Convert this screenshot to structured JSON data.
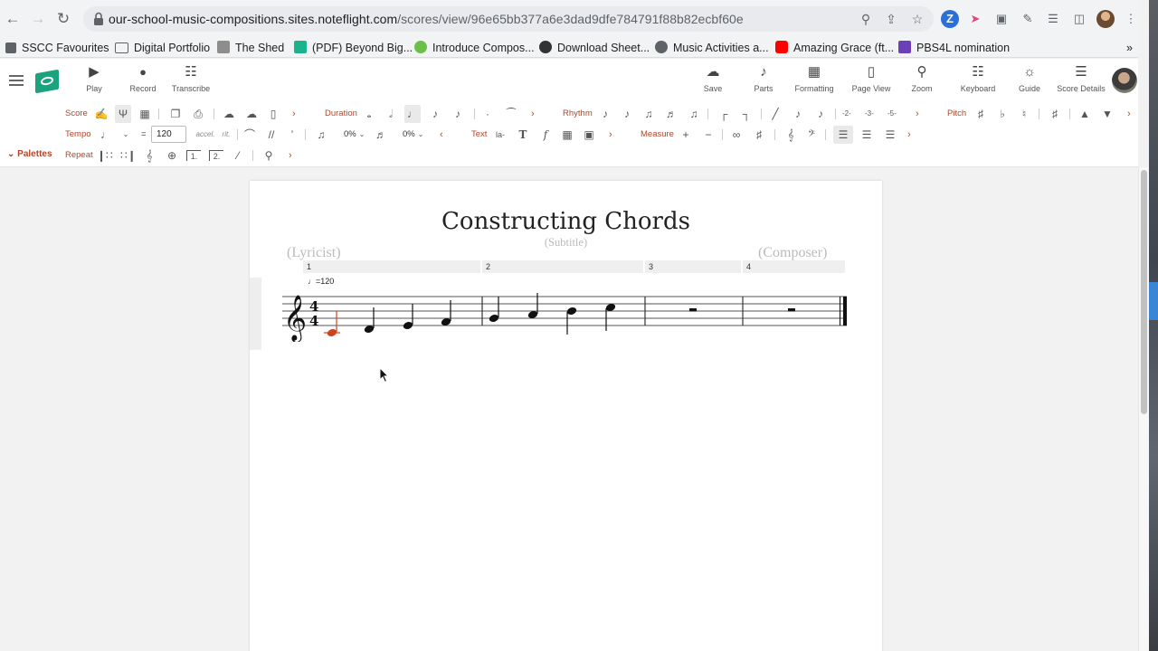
{
  "browser": {
    "url_host": "our-school-music-compositions.sites.noteflight.com",
    "url_path": "/scores/view/96e65bb377a6e3dad9dfe784791f88b82ecbf60e",
    "bookmarks": [
      "SSCC Favourites",
      "Digital Portfolio",
      "The Shed",
      "(PDF) Beyond Big...",
      "Introduce Compos...",
      "Download Sheet...",
      "Music Activities a...",
      "Amazing Grace (ft...",
      "PBS4L nomination"
    ],
    "more_bookmarks": "»"
  },
  "header": {
    "left_buttons": [
      {
        "label": "Play",
        "icon": "play-icon"
      },
      {
        "label": "Record",
        "icon": "record-icon"
      },
      {
        "label": "Transcribe",
        "icon": "piano-icon"
      }
    ],
    "right_buttons": [
      {
        "label": "Save",
        "icon": "cloud-upload-icon"
      },
      {
        "label": "Parts",
        "icon": "guitar-icon"
      },
      {
        "label": "Formatting",
        "icon": "formatting-icon"
      },
      {
        "label": "Page View",
        "icon": "page-icon"
      },
      {
        "label": "Zoom",
        "icon": "zoom-icon"
      },
      {
        "label": "Keyboard",
        "icon": "keyboard-icon"
      },
      {
        "label": "Guide",
        "icon": "compass-icon"
      },
      {
        "label": "Score Details",
        "icon": "list-icon"
      }
    ]
  },
  "toolbar": {
    "row1": {
      "score": "Score",
      "duration": "Duration",
      "rhythm": "Rhythm",
      "pitch": "Pitch",
      "tuplets": [
        "-2-",
        "-3-",
        "-5-"
      ]
    },
    "row2": {
      "tempo": "Tempo",
      "tempo_value": "120",
      "accel": "accel.",
      "rit": "rit.",
      "swing1": "0%",
      "swing2": "0%",
      "text": "Text",
      "lyric": "la-",
      "measure": "Measure"
    },
    "row3": {
      "palettes": "Palettes",
      "repeat": "Repeat",
      "ending1": "1.",
      "ending2": "2."
    }
  },
  "score": {
    "title": "Constructing Chords",
    "subtitle": "(Subtitle)",
    "lyricist": "(Lyricist)",
    "composer": "(Composer)",
    "measure_numbers": [
      "1",
      "2",
      "3",
      "4"
    ],
    "tempo_marking": "=120",
    "time_signature": "4/4",
    "clef": "treble",
    "notes": [
      "C4",
      "D4",
      "E4",
      "F4",
      "G4",
      "A4",
      "B4",
      "C5"
    ],
    "rests": [
      "whole rest",
      "whole rest"
    ],
    "selected_note": "C4",
    "accent_color": "#b4462a",
    "selection_color": "#d0431f"
  }
}
